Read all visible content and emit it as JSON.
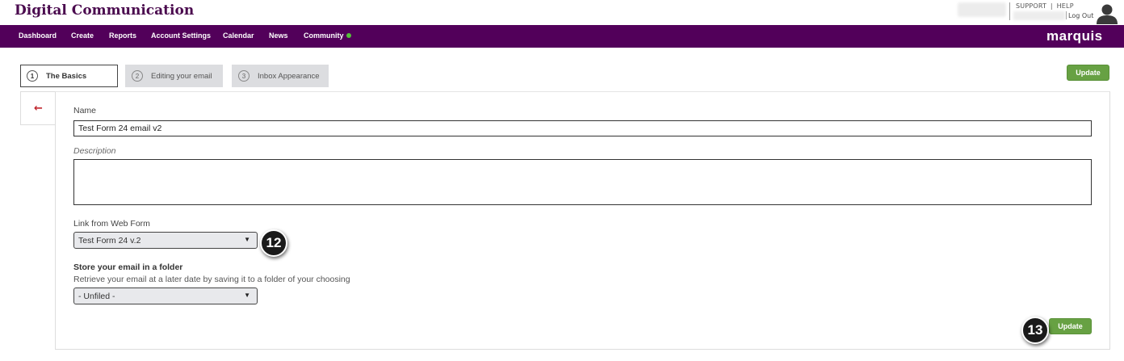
{
  "header": {
    "app_title": "Digital Communication",
    "support": "SUPPORT",
    "separator": "|",
    "help": "HELP",
    "logout": "Log Out"
  },
  "nav": {
    "items": [
      {
        "label": "Dashboard"
      },
      {
        "label": "Create"
      },
      {
        "label": "Reports"
      },
      {
        "label": "Account Settings"
      },
      {
        "label": "Calendar"
      },
      {
        "label": "News"
      },
      {
        "label": "Community"
      }
    ],
    "brand": "marquis",
    "community_status_color": "#55c23a",
    "bar_color": "#52005a"
  },
  "steps": [
    {
      "number": "1",
      "label": "The Basics",
      "active": true
    },
    {
      "number": "2",
      "label": "Editing your email",
      "active": false
    },
    {
      "number": "3",
      "label": "Inbox Appearance",
      "active": false
    }
  ],
  "actions": {
    "update_top": "Update",
    "update_bottom": "Update",
    "button_color": "#67a143"
  },
  "back_icon": "arrow-left-icon",
  "form": {
    "name_label": "Name",
    "name_value": "Test Form 24 email v2",
    "description_label": "Description",
    "description_value": "",
    "web_form_label": "Link from Web Form",
    "web_form_selected": "Test Form 24 v.2",
    "folder_label": "Store your email in a folder",
    "folder_helper": "Retrieve your email at a later date by saving it to a folder of your choosing",
    "folder_selected": "- Unfiled -"
  },
  "callouts": {
    "first": "12",
    "second": "13"
  }
}
